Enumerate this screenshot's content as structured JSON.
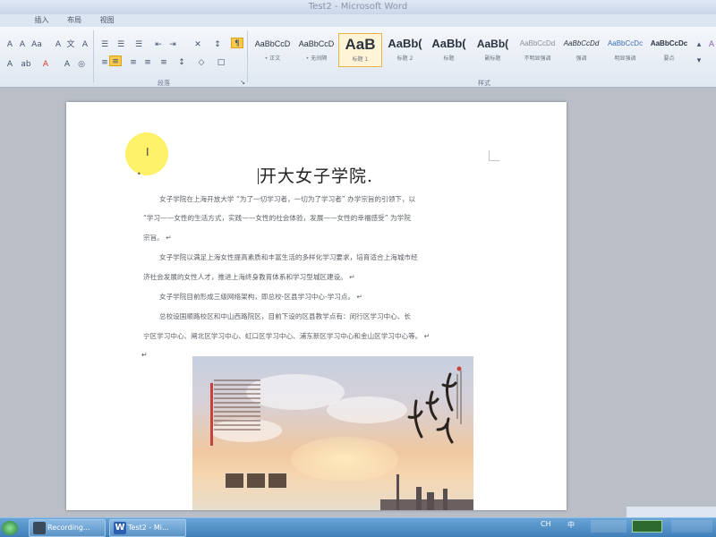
{
  "window": {
    "title": "Test2 - Microsoft Word"
  },
  "menu_tabs": [
    "",
    "插入",
    "布局",
    "视图"
  ],
  "ribbon": {
    "group_labels": {
      "paragraph": "段落",
      "styles": "样式"
    },
    "styles": [
      {
        "preview": "AaBbCcD",
        "name": "• 正文",
        "size": 9
      },
      {
        "preview": "AaBbCcD",
        "name": "• 无间隔",
        "size": 9
      },
      {
        "preview": "AaB",
        "name": "标题 1",
        "size": 17,
        "selected": true
      },
      {
        "preview": "AaBb(",
        "name": "标题 2",
        "size": 13
      },
      {
        "preview": "AaBb(",
        "name": "标题",
        "size": 13
      },
      {
        "preview": "AaBb(",
        "name": "副标题",
        "size": 12
      },
      {
        "preview": "AaBbCcDd",
        "name": "不明显强调",
        "size": 8
      },
      {
        "preview": "AaBbCcDd",
        "name": "强调",
        "size": 8
      },
      {
        "preview": "AaBbCcDc",
        "name": "明显强调",
        "size": 8
      },
      {
        "preview": "AaBbCcDc",
        "name": "要点",
        "size": 8
      }
    ]
  },
  "document": {
    "title": "开大女子学院.",
    "paragraphs": [
      "女子学院在上海开放大学 “为了一切学习者，一切为了学习者” 办学宗旨的引领下，以",
      "“学习——女性的生活方式，实践——女性的社会体验，发展——女性的幸福感受” 为学院",
      "宗旨。 ↵",
      "女子学院以满足上海女性提高素质和丰富生活的多样化学习要求，培育适合上海城市经",
      "济社会发展的女性人才，推进上海终身教育体系和学习型城区建设。 ↵",
      "女子学院目前形成三级网络架构，即总校-区县学习中心-学习点。 ↵",
      "总校设国顺路校区和中山西路院区，目前下设的区县教学点有：闵行区学习中心、长",
      "宁区学习中心、闸北区学习中心、虹口区学习中心、浦东新区学习中心和金山区学习中心等。 ↵"
    ]
  },
  "taskbar": {
    "buttons": [
      {
        "label": "Recording...",
        "icon": "recording-icon"
      },
      {
        "label": "Test2 - Mi...",
        "icon": "word-icon"
      }
    ],
    "tray": {
      "ime": "中",
      "lang": "CH"
    }
  },
  "icons": [
    "start-orb-icon",
    "word-icon",
    "recording-icon",
    "cursor-icon"
  ]
}
